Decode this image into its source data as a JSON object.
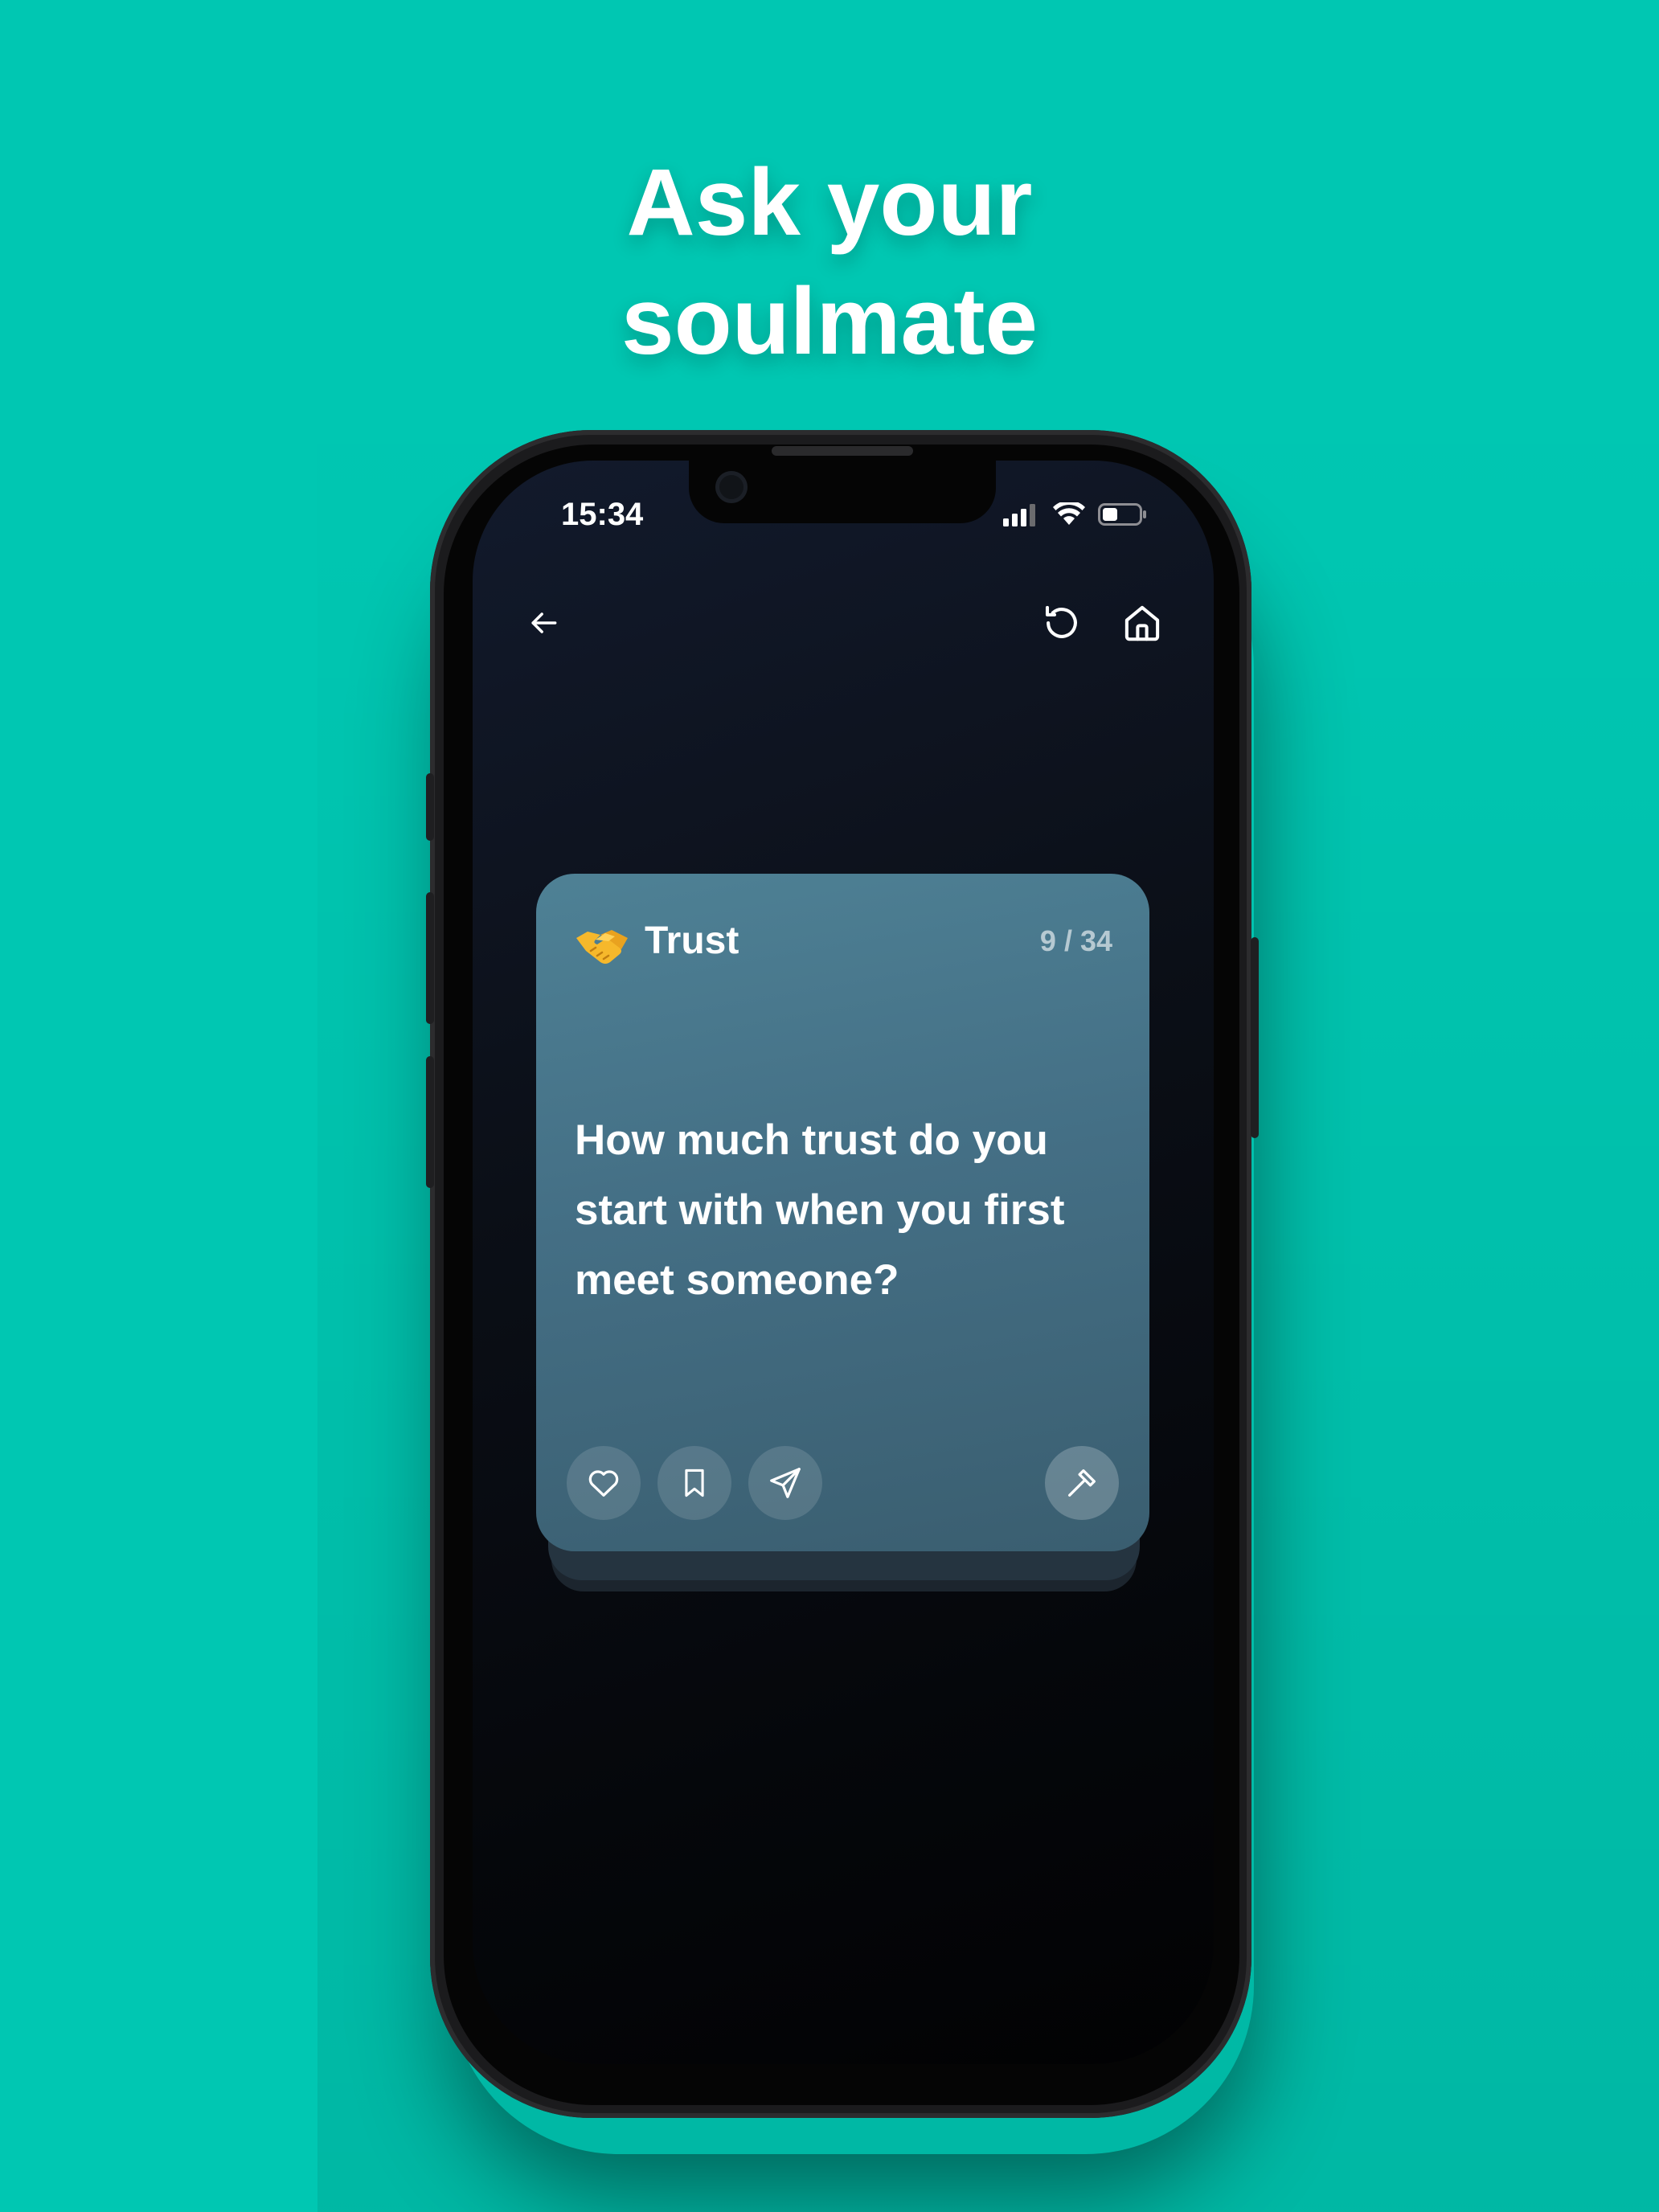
{
  "headline": {
    "line1": "Ask your",
    "line2": "soulmate"
  },
  "status_bar": {
    "time": "15:34"
  },
  "nav": {
    "back_icon": "arrow-left-icon",
    "refresh_icon": "refresh-icon",
    "home_icon": "home-icon"
  },
  "card": {
    "emoji_icon": "handshake-icon",
    "category": "Trust",
    "counter": "9 / 34",
    "question": "How much trust do you start with when you first meet someone?",
    "actions": [
      "heart-icon",
      "bookmark-icon",
      "send-icon",
      "hammer-icon"
    ]
  },
  "colors": {
    "background": "#00C7B2",
    "card_top": "#4e8195",
    "card_bottom": "#3a5e70",
    "screen": "#0b0f17"
  }
}
